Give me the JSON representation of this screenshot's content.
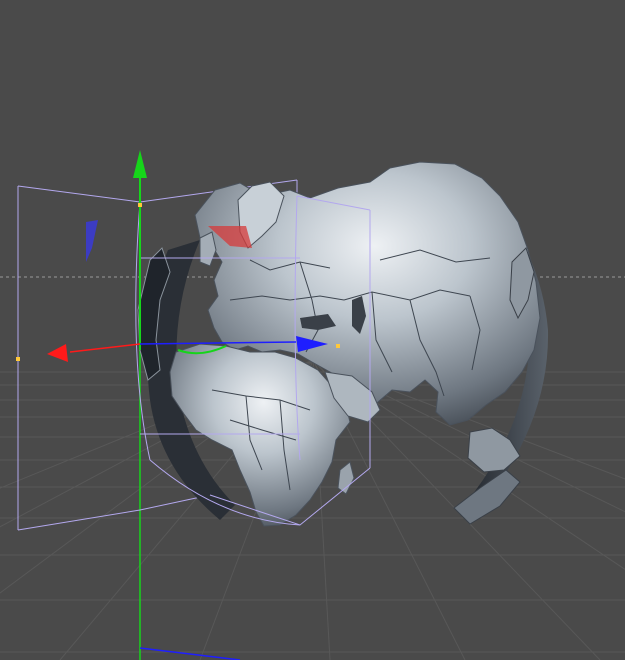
{
  "viewport": {
    "background": "#4a4a4a",
    "grid_color": "#5a5a5a",
    "horizon_color": "#9a9a9a"
  },
  "object": {
    "kind": "3d-globe-model",
    "land_color": "#bcc5cd",
    "land_shadow_color": "#3a4048",
    "selection_box_color": "#b3a8ee"
  },
  "gizmo": {
    "x_axis_color": "#ff1a1a",
    "y_axis_color": "#16d51a",
    "z_axis_color": "#1e1eff",
    "handle_color": "#ffc83a"
  }
}
